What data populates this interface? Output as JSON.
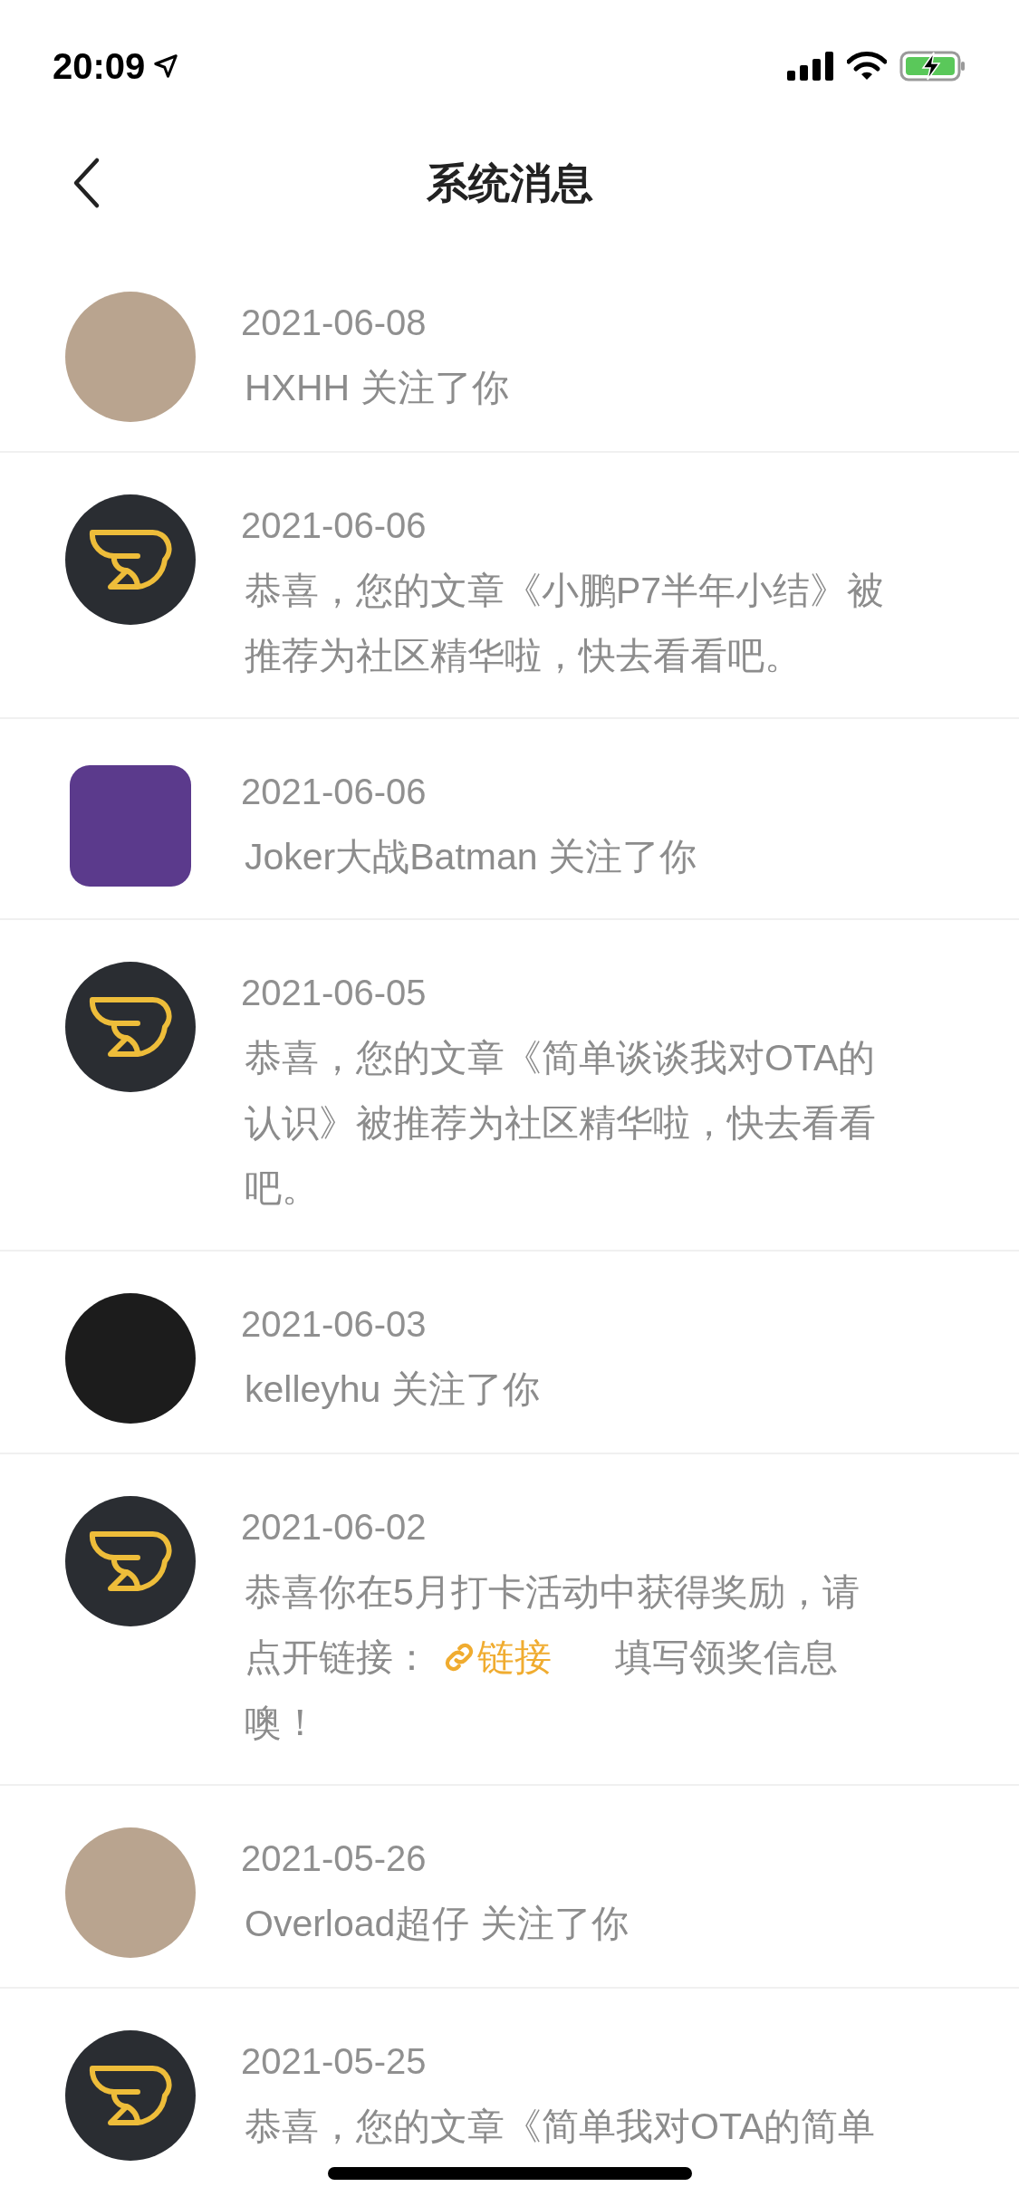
{
  "status_bar": {
    "time": "20:09"
  },
  "nav": {
    "title": "系统消息"
  },
  "messages": [
    {
      "kind": "person-photo",
      "date": "2021-06-08",
      "parts": [
        {
          "kind": "text",
          "text": "HXHH 关注了你"
        }
      ]
    },
    {
      "kind": "brand-logo",
      "date": "2021-06-06",
      "parts": [
        {
          "kind": "text",
          "text": "恭喜，您的文章《小鹏P7半年小结》被推荐为社区精华啦，快去看看吧。"
        }
      ]
    },
    {
      "kind": "square-picture",
      "date": "2021-06-06",
      "parts": [
        {
          "kind": "text",
          "text": "Joker大战Batman 关注了你"
        }
      ]
    },
    {
      "kind": "brand-logo",
      "date": "2021-06-05",
      "parts": [
        {
          "kind": "text",
          "text": "恭喜，您的文章《简单谈谈我对OTA的认识》被推荐为社区精华啦，快去看看吧。"
        }
      ]
    },
    {
      "kind": "dark-photo",
      "date": "2021-06-03",
      "parts": [
        {
          "kind": "text",
          "text": "kelleyhu 关注了你"
        }
      ]
    },
    {
      "kind": "brand-logo",
      "date": "2021-06-02",
      "parts": [
        {
          "kind": "text",
          "text": "恭喜你在5月打卡活动中获得奖励，请点开链接："
        },
        {
          "kind": "link",
          "text": "链接"
        },
        {
          "kind": "text",
          "text": "填写领奖信息噢！"
        }
      ]
    },
    {
      "kind": "person-photo",
      "date": "2021-05-26",
      "parts": [
        {
          "kind": "text",
          "text": "Overload超仔 关注了你"
        }
      ]
    },
    {
      "kind": "brand-logo",
      "date": "2021-05-25",
      "parts": [
        {
          "kind": "text",
          "text": "恭喜，您的文章《简单我对OTA的简单"
        }
      ]
    }
  ]
}
